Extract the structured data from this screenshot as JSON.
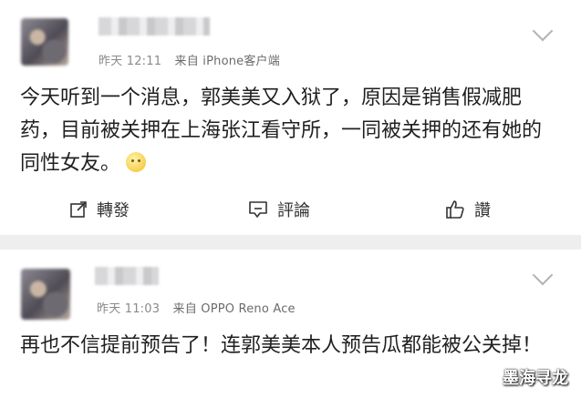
{
  "posts": [
    {
      "nickname": "",
      "time": "昨天 12:11",
      "source": "来自 iPhone客户端",
      "content": "今天听到一个消息，郭美美又入狱了，原因是销售假减肥药，目前被关押在上海张江看守所，一同被关押的还有她的同性女友。",
      "emoji": "smile-emoji",
      "actions": {
        "repost": "轉發",
        "comment": "評論",
        "like": "讚"
      }
    },
    {
      "nickname": "",
      "time": "昨天 11:03",
      "source": "来自 OPPO Reno Ace",
      "content": "再也不信提前预告了！连郭美美本人预告瓜都能被公关掉！"
    }
  ],
  "icons": {
    "repost": "repost-icon",
    "comment": "comment-icon",
    "like": "thumbs-up-icon",
    "chevron": "chevron-down-icon"
  },
  "watermark": "墨海寻龙",
  "colors": {
    "separator": "#eeeeee",
    "meta_text": "#8a8a8a",
    "content_text": "#1f1f1f"
  }
}
